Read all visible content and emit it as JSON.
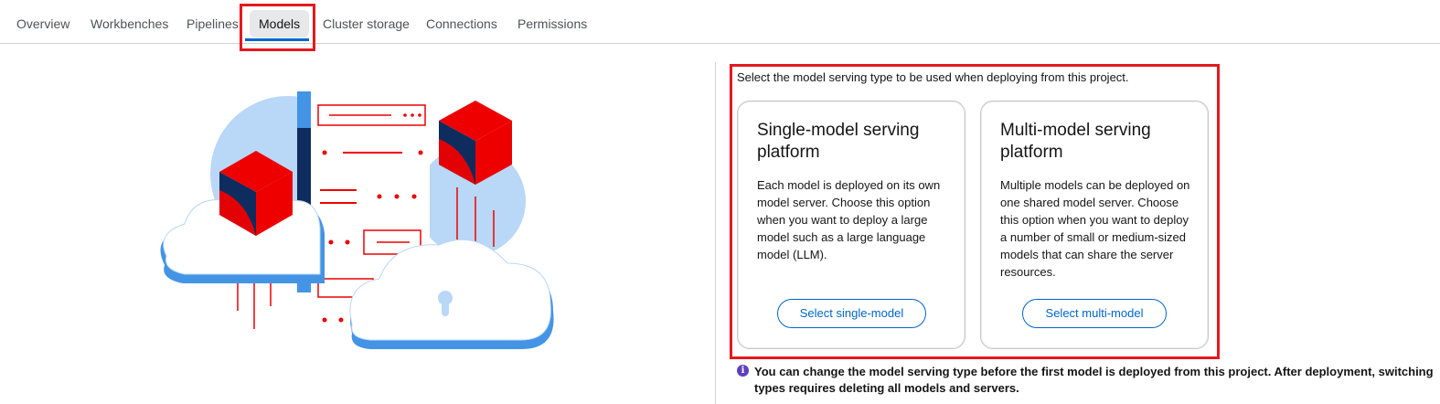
{
  "tabs": [
    {
      "label": "Overview",
      "active": false
    },
    {
      "label": "Workbenches",
      "active": false
    },
    {
      "label": "Pipelines",
      "active": false
    },
    {
      "label": "Models",
      "active": true
    },
    {
      "label": "Cluster storage",
      "active": false
    },
    {
      "label": "Connections",
      "active": false
    },
    {
      "label": "Permissions",
      "active": false
    }
  ],
  "intro": "Select the model serving type to be used when deploying from this project.",
  "cards": [
    {
      "title": "Single-model serving platform",
      "body": "Each model is deployed on its own model server. Choose this option when you want to deploy a large model such as a large language model (LLM).",
      "button": "Select single-model"
    },
    {
      "title": "Multi-model serving platform",
      "body": "Multiple models can be deployed on one shared model server. Choose this option when you want to deploy a number of small or medium-sized models that can share the server resources.",
      "button": "Select multi-model"
    }
  ],
  "info": {
    "icon": "info-icon",
    "text": "You can change the model serving type before the first model is deployed from this project. After deployment, switching types requires deleting all models and servers."
  },
  "colors": {
    "accent": "#0066cc",
    "highlight": "#e3191f",
    "brand_red": "#ee0000",
    "info_purple": "#5e40be"
  }
}
